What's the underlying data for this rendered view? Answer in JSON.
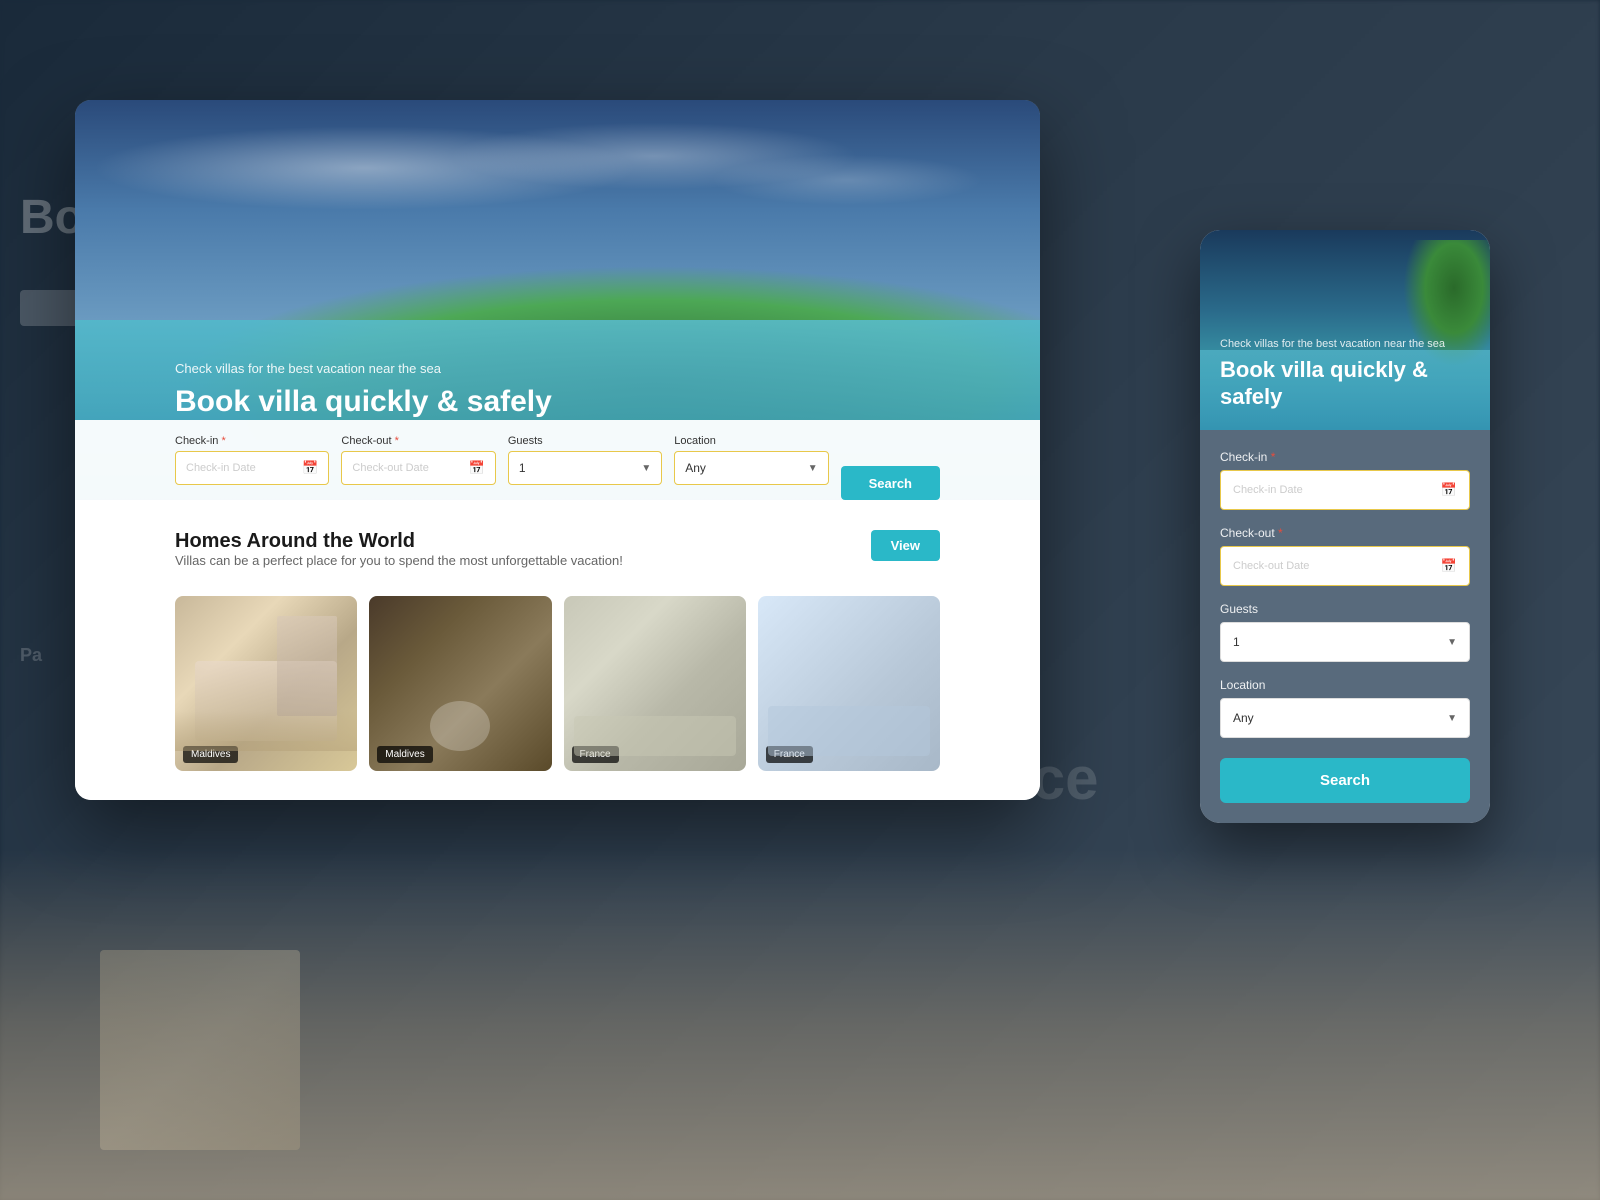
{
  "background": {
    "trance_text": "Trance"
  },
  "hero": {
    "subtitle": "Check villas for the best vacation near the sea",
    "title": "Book villa quickly & safely",
    "search": {
      "checkin_label": "Check-in",
      "checkin_placeholder": "Check-in Date",
      "checkout_label": "Check-out",
      "checkout_placeholder": "Check-out Date",
      "guests_label": "Guests",
      "guests_value": "1",
      "location_label": "Location",
      "location_value": "Any",
      "search_button": "Search"
    }
  },
  "content": {
    "section_title": "Homes Around the World",
    "section_subtitle": "Villas can be a perfect place for you to spend the most unforgettable vacation!",
    "view_button": "View",
    "properties": [
      {
        "location": "Maldives",
        "type": "bathroom"
      },
      {
        "location": "Maldives",
        "type": "outdoor"
      },
      {
        "location": "France",
        "type": "living"
      },
      {
        "location": "France",
        "type": "bedroom"
      }
    ]
  },
  "mobile": {
    "hero": {
      "subtitle": "Check villas for the best vacation near the sea",
      "title": "Book villa quickly & safely"
    },
    "form": {
      "checkin_label": "Check-in",
      "checkin_required": "*",
      "checkin_placeholder": "Check-in Date",
      "checkout_label": "Check-out",
      "checkout_required": "*",
      "checkout_placeholder": "Check-out Date",
      "guests_label": "Guests",
      "guests_value": "1",
      "location_label": "Location",
      "location_value": "Any",
      "search_button": "Search"
    }
  }
}
